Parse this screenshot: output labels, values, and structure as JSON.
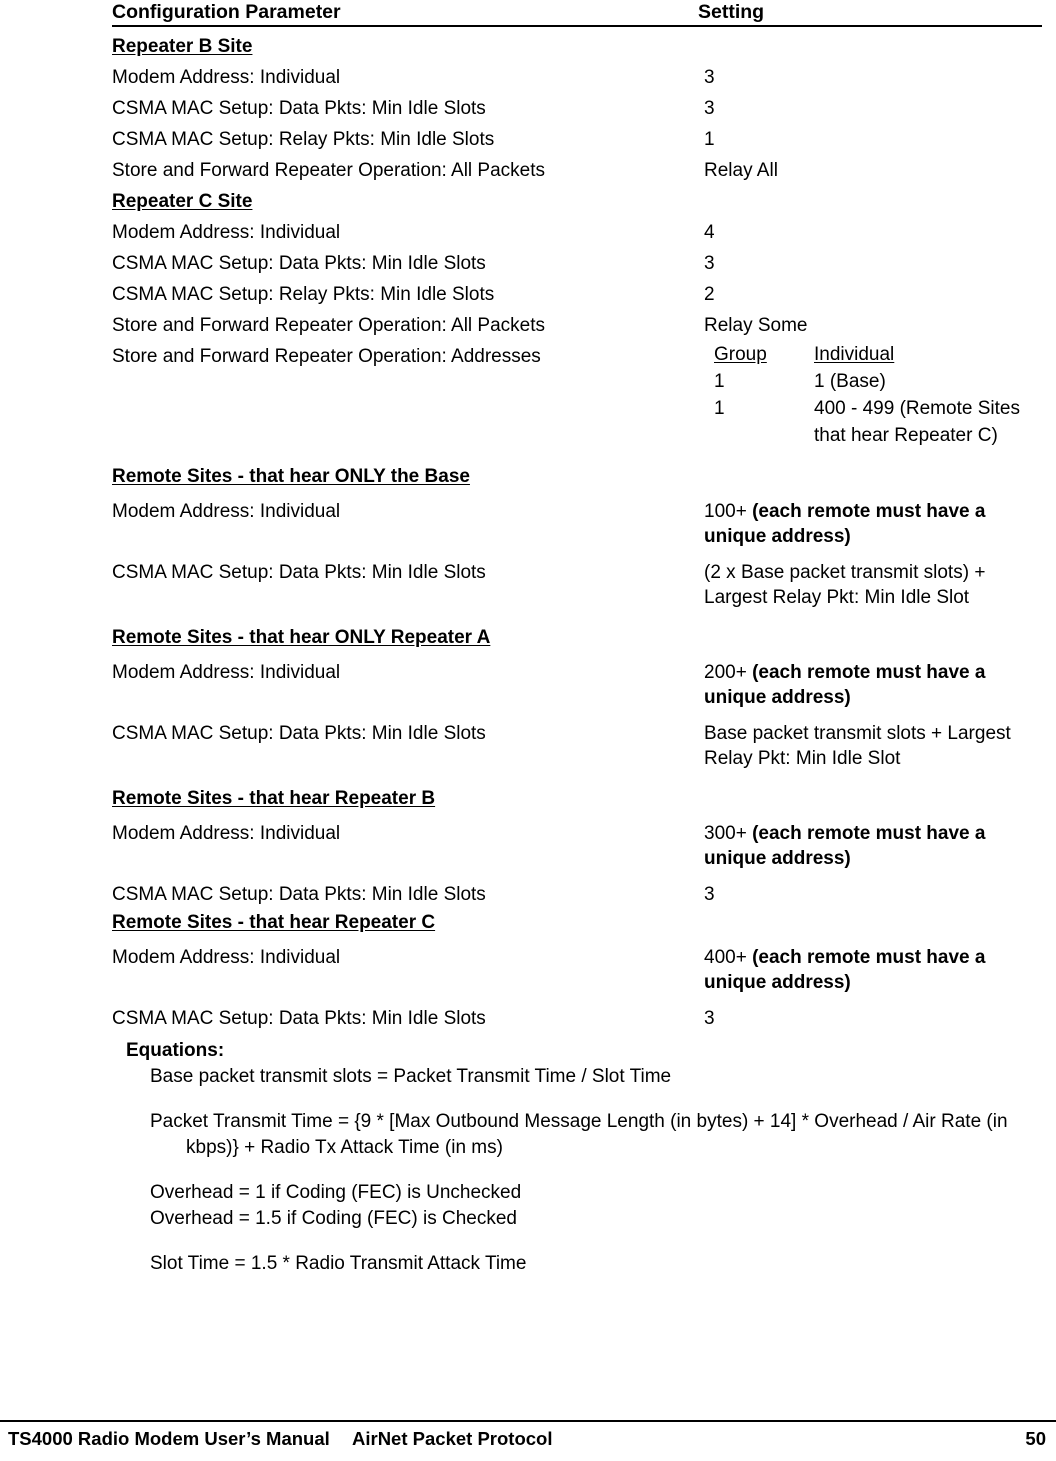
{
  "table": {
    "headers": {
      "parameter": "Configuration Parameter",
      "setting": "Setting"
    },
    "sections": [
      {
        "title": "Repeater B Site",
        "rows": [
          {
            "parameter": "Modem Address: Individual",
            "setting": "3"
          },
          {
            "parameter": "CSMA MAC Setup: Data Pkts: Min Idle Slots",
            "setting": "3"
          },
          {
            "parameter": "CSMA MAC Setup: Relay Pkts: Min Idle Slots",
            "setting": "1"
          },
          {
            "parameter": "Store and Forward Repeater Operation: All Packets",
            "setting": "Relay All"
          }
        ]
      },
      {
        "title": "Repeater C Site",
        "rows": [
          {
            "parameter": "Modem Address: Individual",
            "setting": "4"
          },
          {
            "parameter": "CSMA MAC Setup: Data Pkts: Min Idle Slots",
            "setting": "3"
          },
          {
            "parameter": "CSMA MAC Setup: Relay Pkts: Min Idle Slots",
            "setting": "2"
          },
          {
            "parameter": "Store and Forward Repeater Operation: All Packets",
            "setting": "Relay Some"
          },
          {
            "parameter": "Store and Forward Repeater Operation: Addresses",
            "setting": ""
          }
        ],
        "address_table": {
          "col_group": "Group",
          "col_individual": "Individual",
          "entries": [
            {
              "group": "1",
              "individual": "1 (Base)"
            },
            {
              "group": "1",
              "individual": "400 - 499 (Remote Sites that hear Repeater C)"
            }
          ]
        }
      },
      {
        "title": "Remote Sites - that hear ONLY the Base",
        "rows": [
          {
            "parameter": "Modem Address: Individual",
            "setting_plain": "100+ ",
            "setting_bold": "(each remote must have a unique address)"
          },
          {
            "parameter": "CSMA MAC Setup: Data Pkts: Min Idle Slots",
            "setting_plain": "(2 x Base packet transmit slots) + Largest Relay Pkt: Min Idle Slot",
            "setting_bold": ""
          }
        ]
      },
      {
        "title": "Remote Sites - that hear ONLY Repeater A",
        "rows": [
          {
            "parameter": "Modem Address: Individual",
            "setting_plain": "200+ ",
            "setting_bold": "(each remote must have a unique address)"
          },
          {
            "parameter": "CSMA MAC Setup: Data Pkts: Min Idle Slots",
            "setting_plain": "Base packet transmit slots + Largest Relay Pkt: Min Idle Slot",
            "setting_bold": ""
          }
        ]
      },
      {
        "title": "Remote Sites - that hear Repeater B",
        "rows": [
          {
            "parameter": "Modem Address: Individual",
            "setting_plain": "300+ ",
            "setting_bold": "(each remote must have a unique address)"
          },
          {
            "parameter": "CSMA MAC Setup: Data Pkts: Min Idle Slots",
            "setting_plain": "3",
            "setting_bold": ""
          }
        ]
      },
      {
        "title": "Remote Sites - that hear Repeater C",
        "rows": [
          {
            "parameter": "Modem Address: Individual",
            "setting_plain": "400+ ",
            "setting_bold": "(each remote must have a unique address)"
          },
          {
            "parameter": "CSMA MAC Setup: Data Pkts: Min Idle Slots",
            "setting_plain": "3",
            "setting_bold": ""
          }
        ]
      }
    ]
  },
  "equations": {
    "title": "Equations:",
    "lines": [
      "Base packet transmit slots = Packet Transmit Time / Slot Time",
      "Packet Transmit Time = {9 * [Max Outbound Message Length (in bytes) + 14] * Overhead / Air Rate (in kbps)} + Radio Tx Attack Time (in ms)",
      "Overhead = 1 if Coding (FEC) is Unchecked",
      "Overhead = 1.5 if Coding (FEC) is Checked",
      "Slot Time = 1.5 * Radio Transmit Attack Time"
    ]
  },
  "footer": {
    "left": "TS4000 Radio Modem User’s Manual",
    "center": "AirNet Packet Protocol",
    "page_number": "50"
  }
}
